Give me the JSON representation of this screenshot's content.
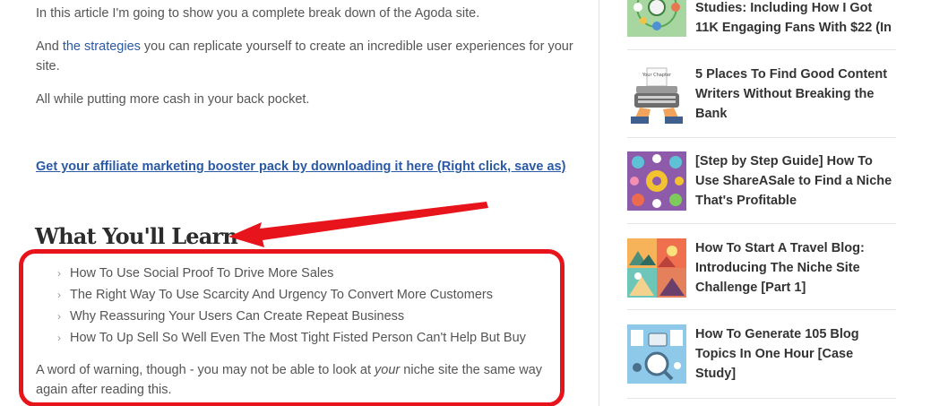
{
  "article": {
    "intro": "In this article I'm going to show you a complete break down of the Agoda site.",
    "p2_prefix": "And ",
    "p2_link": "the strategies",
    "p2_suffix": " you can replicate yourself to create an incredible user experiences for your site.",
    "p3": "All while putting more cash in your back pocket.",
    "booster_link": "Get your affiliate marketing booster pack by downloading it here (Right click, save as)",
    "heading": "What You'll Learn",
    "learn_items": [
      "How To Use Social Proof To Drive More Sales",
      "The Right Way To Use Scarcity And Urgency To Convert More Customers",
      "Why Reassuring Your Users Can Create Repeat Business",
      "How To Up Sell So Well Even The Most Tight Fisted Person Can't Help But Buy"
    ],
    "warning_prefix": "A word of warning, though - you may not be able to look at ",
    "warning_em": "your",
    "warning_suffix": " niche site the same way again after reading this.",
    "annotation_color": "#e8141c",
    "link_color": "#2a59a6"
  },
  "sidebar": {
    "posts": [
      {
        "title": "Studies: Including How I Got 11K Engaging Fans With $22 (In",
        "thumb": "community-network-icon"
      },
      {
        "title": "5 Places To Find Good Content Writers Without Breaking the Bank",
        "thumb": "typewriter-icon",
        "thumb_caption": "Your Chapter"
      },
      {
        "title": "[Step by Step Guide] How To Use ShareASale to Find a Niche That's Profitable",
        "thumb": "marketing-icons-grid"
      },
      {
        "title": "How To Start A Travel Blog: Introducing The Niche Site Challenge [Part 1]",
        "thumb": "travel-landscapes-grid"
      },
      {
        "title": "How To Generate 105 Blog Topics In One Hour [Case Study]",
        "thumb": "blog-tools-icon"
      }
    ]
  }
}
